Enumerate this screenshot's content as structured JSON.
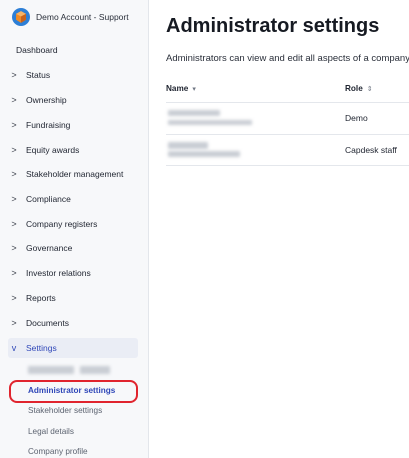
{
  "account": {
    "name": "Demo Account - Support",
    "logo_icon": "company-logo-icon"
  },
  "sidebar": {
    "dashboard": "Dashboard",
    "items": [
      {
        "label": "Status",
        "chevron": ">"
      },
      {
        "label": "Ownership",
        "chevron": ">"
      },
      {
        "label": "Fundraising",
        "chevron": ">"
      },
      {
        "label": "Equity awards",
        "chevron": ">"
      },
      {
        "label": "Stakeholder management",
        "chevron": ">"
      },
      {
        "label": "Compliance",
        "chevron": ">"
      },
      {
        "label": "Company registers",
        "chevron": ">"
      },
      {
        "label": "Governance",
        "chevron": ">"
      },
      {
        "label": "Investor relations",
        "chevron": ">"
      },
      {
        "label": "Reports",
        "chevron": ">"
      },
      {
        "label": "Documents",
        "chevron": ">"
      },
      {
        "label": "Settings",
        "chevron": "v"
      }
    ],
    "settings_sub": [
      {
        "label": "Administrator settings"
      },
      {
        "label": "Stakeholder settings"
      },
      {
        "label": "Legal details"
      },
      {
        "label": "Company profile"
      }
    ]
  },
  "main": {
    "title": "Administrator settings",
    "description": "Administrators can view and edit all aspects of a company,",
    "table": {
      "columns": [
        {
          "label": "Name",
          "sort_icon": "▾"
        },
        {
          "label": "Role",
          "sort_icon": "⇕"
        }
      ],
      "rows": [
        {
          "role": "Demo"
        },
        {
          "role": "Capdesk staff"
        }
      ]
    }
  },
  "colors": {
    "accent": "#2f47b8",
    "highlight_outline": "#e0242e",
    "sidebar_bg": "#f7f8fa"
  }
}
